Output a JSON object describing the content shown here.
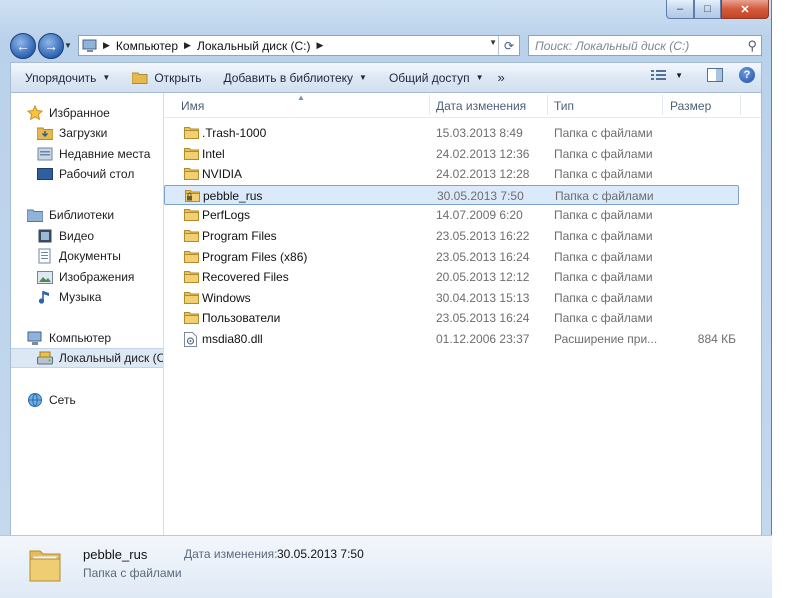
{
  "window": {
    "minimize_glyph": "–",
    "maximize_glyph": "□",
    "close_glyph": "✕"
  },
  "navigation": {
    "back_glyph": "←",
    "forward_glyph": "→",
    "address": [
      "Компьютер",
      "Локальный диск (C:)"
    ],
    "search_placeholder": "Поиск: Локальный диск (C:)"
  },
  "toolbar": {
    "organize": "Упорядочить",
    "open": "Открыть",
    "add_to_library": "Добавить в библиотеку",
    "share": "Общий доступ",
    "more": "»",
    "help": "?"
  },
  "sidebar": {
    "favorites": {
      "label": "Избранное",
      "items": [
        "Загрузки",
        "Недавние места",
        "Рабочий стол"
      ]
    },
    "libraries": {
      "label": "Библиотеки",
      "items": [
        "Видео",
        "Документы",
        "Изображения",
        "Музыка"
      ]
    },
    "computer": {
      "label": "Компьютер",
      "items": [
        "Локальный диск (C"
      ]
    },
    "network": {
      "label": "Сеть"
    }
  },
  "columns": {
    "name": "Имя",
    "date": "Дата изменения",
    "type": "Тип",
    "size": "Размер"
  },
  "files": [
    {
      "name": ".Trash-1000",
      "date": "15.03.2013 8:49",
      "type": "Папка с файлами",
      "size": "",
      "icon": "folder-icon"
    },
    {
      "name": "Intel",
      "date": "24.02.2013 12:36",
      "type": "Папка с файлами",
      "size": "",
      "icon": "folder-icon"
    },
    {
      "name": "NVIDIA",
      "date": "24.02.2013 12:28",
      "type": "Папка с файлами",
      "size": "",
      "icon": "folder-icon"
    },
    {
      "name": "pebble_rus",
      "date": "30.05.2013 7:50",
      "type": "Папка с файлами",
      "size": "",
      "icon": "locked-folder-icon",
      "selected": true
    },
    {
      "name": "PerfLogs",
      "date": "14.07.2009 6:20",
      "type": "Папка с файлами",
      "size": "",
      "icon": "folder-icon"
    },
    {
      "name": "Program Files",
      "date": "23.05.2013 16:22",
      "type": "Папка с файлами",
      "size": "",
      "icon": "folder-icon"
    },
    {
      "name": "Program Files (x86)",
      "date": "23.05.2013 16:24",
      "type": "Папка с файлами",
      "size": "",
      "icon": "folder-icon"
    },
    {
      "name": "Recovered Files",
      "date": "20.05.2013 12:12",
      "type": "Папка с файлами",
      "size": "",
      "icon": "folder-icon"
    },
    {
      "name": "Windows",
      "date": "30.04.2013 15:13",
      "type": "Папка с файлами",
      "size": "",
      "icon": "folder-icon"
    },
    {
      "name": "Пользователи",
      "date": "23.05.2013 16:24",
      "type": "Папка с файлами",
      "size": "",
      "icon": "folder-icon"
    },
    {
      "name": "msdia80.dll",
      "date": "01.12.2006 23:37",
      "type": "Расширение при...",
      "size": "884 КБ",
      "icon": "dll-file-icon"
    }
  ],
  "details": {
    "name": "pebble_rus",
    "type": "Папка с файлами",
    "date_label": "Дата изменения:",
    "date_value": "30.05.2013 7:50"
  },
  "colors": {
    "selection": "#dbeafb",
    "selection_border": "#7da2ce",
    "folder": "#e8c25a"
  }
}
